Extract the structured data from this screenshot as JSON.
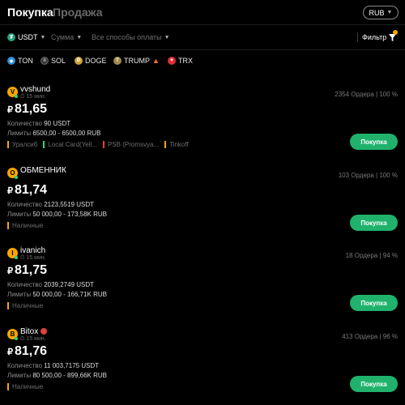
{
  "header": {
    "tab_buy": "Покупка",
    "tab_sell": "Продажа",
    "currency": "RUB"
  },
  "filters": {
    "asset": "USDT",
    "amount": "Сумма",
    "payment": "Все способы оплаты",
    "filter_label": "Фильтр",
    "filter_badge_count": "1"
  },
  "coins": [
    {
      "name": "TON",
      "color": "#2a8fd6"
    },
    {
      "name": "SOL",
      "color": "#3a3a3a"
    },
    {
      "name": "DOGE",
      "color": "#c9a23a"
    },
    {
      "name": "TRUMP",
      "color": "#a08a4a"
    },
    {
      "name": "TRX",
      "color": "#e02d35"
    }
  ],
  "listings": [
    {
      "avatar": "V",
      "avatar_color": "#f7a600",
      "nick": "vvshund",
      "time": "15 мин.",
      "price": "81,65",
      "qty_label": "Количество",
      "qty": "90 USDT",
      "limit_label": "Лимиты",
      "limit": "6500,00 - 6500,00 RUB",
      "payments": [
        {
          "name": "Уралсиб",
          "color": "#f7a600"
        },
        {
          "name": "Local Card(Yell...",
          "color": "#2ed47a"
        },
        {
          "name": "PSB (Promsvya...",
          "color": "#e04040"
        },
        {
          "name": "Tinkoff",
          "color": "#f7a600"
        }
      ],
      "orders": "2354 Ордера | 100 %",
      "button": "Покупка"
    },
    {
      "avatar": "О",
      "avatar_color": "#f7a600",
      "nick": "ОБМЕННИК",
      "time": "",
      "price": "81,74",
      "qty_label": "Количество",
      "qty": "2123,5519 USDT",
      "limit_label": "Лимиты",
      "limit": "50 000,00 - 173,58K RUB",
      "payments": [
        {
          "name": "Наличные",
          "color": "#f7a600"
        }
      ],
      "orders": "103 Ордера | 100 %",
      "button": "Покупка"
    },
    {
      "avatar": "I",
      "avatar_color": "#f7a600",
      "nick": "ivanich",
      "time": "15 мин.",
      "price": "81,75",
      "qty_label": "Количество",
      "qty": "2039,2749 USDT",
      "limit_label": "Лимиты",
      "limit": "50 000,00 - 166,71K RUB",
      "payments": [
        {
          "name": "Наличные",
          "color": "#f7a600"
        }
      ],
      "orders": "18 Ордера | 94 %",
      "button": "Покупка"
    },
    {
      "avatar": "B",
      "avatar_color": "#f7a600",
      "nick": "Bitox",
      "time": "15 мин.",
      "price": "81,76",
      "qty_label": "Количество",
      "qty": "11 003,7175 USDT",
      "limit_label": "Лимиты",
      "limit": "80 500,00 - 899,66K RUB",
      "payments": [
        {
          "name": "Наличные",
          "color": "#f7a600"
        }
      ],
      "orders": "413 Ордера | 96 %",
      "button": "Покупка"
    }
  ]
}
